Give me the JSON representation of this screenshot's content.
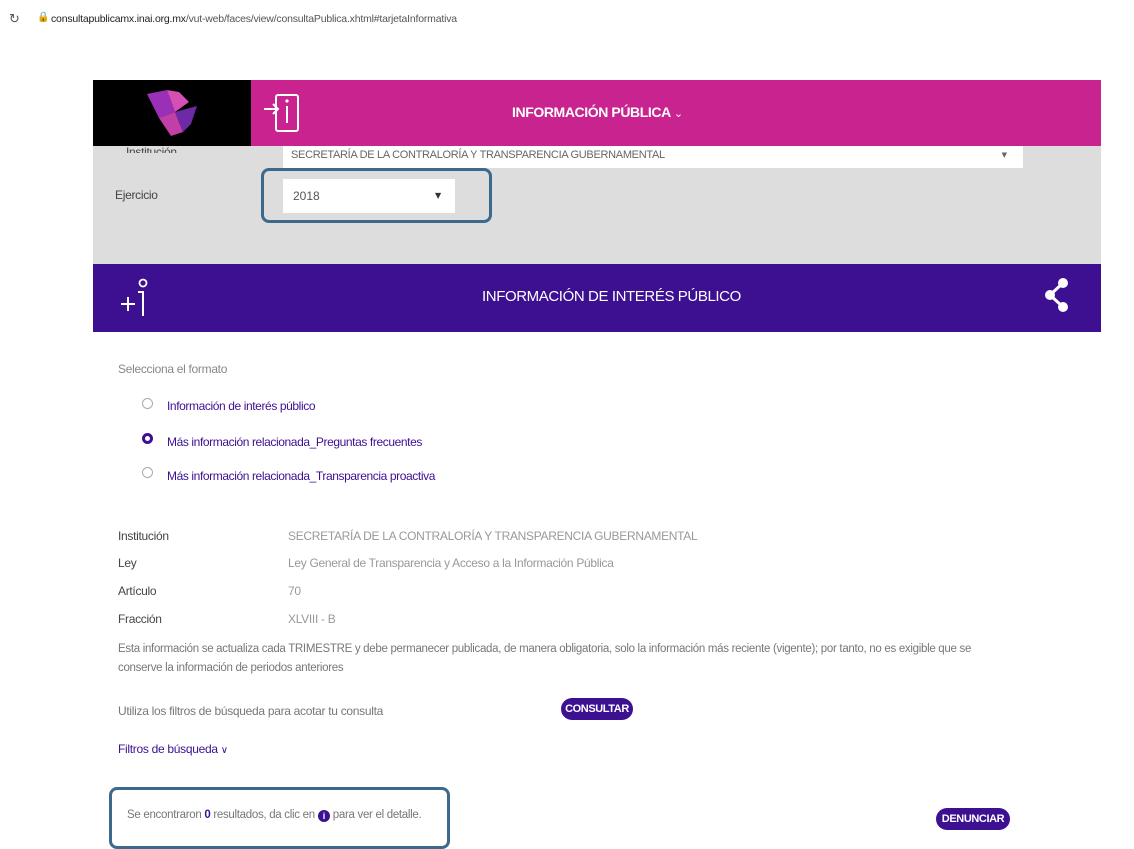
{
  "browser": {
    "url_host": "consultapublicamx.inai.org.mx",
    "url_path": "/vut-web/faces/view/consultaPublica.xhtml#tarjetaInformativa"
  },
  "header": {
    "menu_label": "INFORMACIÓN PÚBLICA"
  },
  "filters": {
    "institution_label": "Institución",
    "institution_value": "SECRETARÍA DE LA CONTRALORÍA Y TRANSPARENCIA GUBERNAMENTAL",
    "year_label": "Ejercicio",
    "year_value": "2018"
  },
  "banner": {
    "title": "INFORMACIÓN DE INTERÉS PÚBLICO"
  },
  "format": {
    "prompt": "Selecciona el formato",
    "options": [
      {
        "label": "Información de interés público",
        "selected": false
      },
      {
        "label": "Más información relacionada_Preguntas frecuentes",
        "selected": true
      },
      {
        "label": "Más información relacionada_Transparencia proactiva",
        "selected": false
      }
    ]
  },
  "details": {
    "institucion_label": "Institución",
    "institucion_value": "SECRETARÍA DE LA CONTRALORÍA Y TRANSPARENCIA GUBERNAMENTAL",
    "ley_label": "Ley",
    "ley_value": "Ley General de Transparencia y Acceso a la Información Pública",
    "articulo_label": "Artículo",
    "articulo_value": "70",
    "fraccion_label": "Fracción",
    "fraccion_value": "XLVIII - B",
    "note": "Esta información se actualiza cada TRIMESTRE y debe permanecer publicada, de manera obligatoria, solo la información más reciente (vigente); por tanto, no es exigible que se conserve la información de periodos anteriores"
  },
  "search": {
    "hint": "Utiliza los filtros de búsqueda para acotar tu consulta",
    "consult_button": "CONSULTAR",
    "filters_link": "Filtros de búsqueda"
  },
  "results": {
    "prefix": "Se encontraron",
    "count": "0",
    "middle": "resultados, da clic en",
    "suffix": "para ver el detalle.",
    "info_glyph": "i",
    "report_button": "DENUNCIAR"
  },
  "colors": {
    "header_magenta": "#c9238f",
    "banner_purple": "#3d0f91",
    "panel_grey": "#dddddd",
    "highlight_box": "#3d6a8c"
  }
}
